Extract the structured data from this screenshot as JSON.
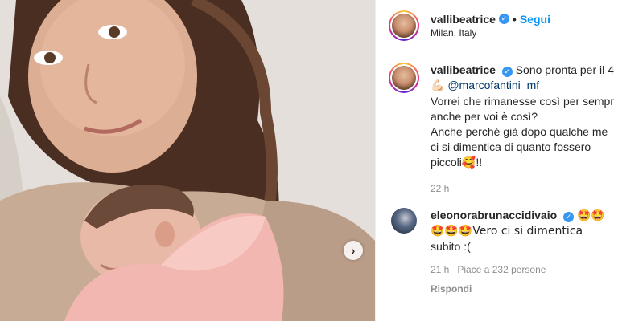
{
  "post": {
    "image_alt": "Selfie with newborn baby",
    "next_icon": "chevron-right-icon"
  },
  "header": {
    "username": "vallibeatrice",
    "dot": "•",
    "follow_label": "Segui",
    "location": "Milan, Italy",
    "verified_icon": "verified-badge-icon"
  },
  "caption": {
    "username": "vallibeatrice",
    "text_line1": "Sono pronta per il 4",
    "arm_emoji": "💪🏻",
    "mention": "@marcofantini_mf",
    "lines": [
      "Vorrei che rimanesse così per sempr",
      "anche per voi è così?",
      "Anche perché già dopo qualche me",
      "ci si dimentica di quanto fossero",
      "piccoli🥰!!"
    ],
    "time": "22 h"
  },
  "comment": {
    "username": "eleonorabrunaccidivaio",
    "emojis_inline": "🤩🤩",
    "text_line2": "🤩🤩🤩Vero ci si dimentica",
    "text_line3": "subito :(",
    "time": "21 h",
    "likes": "Piace a 232 persone",
    "reply": "Rispondi"
  },
  "colors": {
    "accent": "#0095f6",
    "verified": "#3897f0",
    "mention": "#00376b",
    "muted": "#8e8e8e"
  }
}
